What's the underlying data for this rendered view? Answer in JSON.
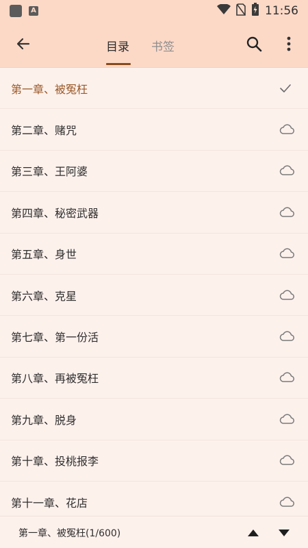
{
  "status_bar": {
    "time": "11:56",
    "icons": [
      "app-square-icon",
      "a-badge-icon",
      "wifi-icon",
      "sim-off-icon",
      "battery-icon"
    ],
    "a_badge": "A"
  },
  "toolbar": {
    "back_icon": "arrow-left-icon",
    "tabs": [
      {
        "label": "目录",
        "selected": true
      },
      {
        "label": "书签",
        "selected": false
      }
    ],
    "search_icon": "search-icon",
    "more_icon": "more-vertical-icon"
  },
  "chapters": [
    {
      "title": "第一章、被冤枉",
      "status_icon": "check-icon",
      "current": true
    },
    {
      "title": "第二章、赌咒",
      "status_icon": "cloud-icon",
      "current": false
    },
    {
      "title": "第三章、王阿婆",
      "status_icon": "cloud-icon",
      "current": false
    },
    {
      "title": "第四章、秘密武器",
      "status_icon": "cloud-icon",
      "current": false
    },
    {
      "title": "第五章、身世",
      "status_icon": "cloud-icon",
      "current": false
    },
    {
      "title": "第六章、克星",
      "status_icon": "cloud-icon",
      "current": false
    },
    {
      "title": "第七章、第一份活",
      "status_icon": "cloud-icon",
      "current": false
    },
    {
      "title": "第八章、再被冤枉",
      "status_icon": "cloud-icon",
      "current": false
    },
    {
      "title": "第九章、脱身",
      "status_icon": "cloud-icon",
      "current": false
    },
    {
      "title": "第十章、投桃报李",
      "status_icon": "cloud-icon",
      "current": false
    },
    {
      "title": "第十一章、花店",
      "status_icon": "cloud-icon",
      "current": false
    }
  ],
  "bottom_bar": {
    "current_label": "第一章、被冤枉(1/600)",
    "up_icon": "triangle-up-icon",
    "down_icon": "triangle-down-icon"
  },
  "colors": {
    "header_bg": "#fcd9c7",
    "list_bg": "#fdf1ec",
    "accent": "#8a4b1c",
    "current_text": "#9a5a2a"
  }
}
